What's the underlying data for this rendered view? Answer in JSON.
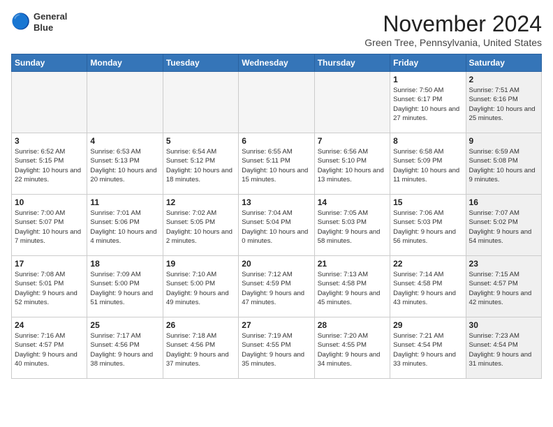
{
  "header": {
    "logo_line1": "General",
    "logo_line2": "Blue",
    "month": "November 2024",
    "location": "Green Tree, Pennsylvania, United States"
  },
  "weekdays": [
    "Sunday",
    "Monday",
    "Tuesday",
    "Wednesday",
    "Thursday",
    "Friday",
    "Saturday"
  ],
  "weeks": [
    [
      {
        "day": "",
        "info": "",
        "empty": true
      },
      {
        "day": "",
        "info": "",
        "empty": true
      },
      {
        "day": "",
        "info": "",
        "empty": true
      },
      {
        "day": "",
        "info": "",
        "empty": true
      },
      {
        "day": "",
        "info": "",
        "empty": true
      },
      {
        "day": "1",
        "info": "Sunrise: 7:50 AM\nSunset: 6:17 PM\nDaylight: 10 hours and 27 minutes.",
        "empty": false,
        "shaded": false
      },
      {
        "day": "2",
        "info": "Sunrise: 7:51 AM\nSunset: 6:16 PM\nDaylight: 10 hours and 25 minutes.",
        "empty": false,
        "shaded": true
      }
    ],
    [
      {
        "day": "3",
        "info": "Sunrise: 6:52 AM\nSunset: 5:15 PM\nDaylight: 10 hours and 22 minutes.",
        "empty": false,
        "shaded": false
      },
      {
        "day": "4",
        "info": "Sunrise: 6:53 AM\nSunset: 5:13 PM\nDaylight: 10 hours and 20 minutes.",
        "empty": false,
        "shaded": false
      },
      {
        "day": "5",
        "info": "Sunrise: 6:54 AM\nSunset: 5:12 PM\nDaylight: 10 hours and 18 minutes.",
        "empty": false,
        "shaded": false
      },
      {
        "day": "6",
        "info": "Sunrise: 6:55 AM\nSunset: 5:11 PM\nDaylight: 10 hours and 15 minutes.",
        "empty": false,
        "shaded": false
      },
      {
        "day": "7",
        "info": "Sunrise: 6:56 AM\nSunset: 5:10 PM\nDaylight: 10 hours and 13 minutes.",
        "empty": false,
        "shaded": false
      },
      {
        "day": "8",
        "info": "Sunrise: 6:58 AM\nSunset: 5:09 PM\nDaylight: 10 hours and 11 minutes.",
        "empty": false,
        "shaded": false
      },
      {
        "day": "9",
        "info": "Sunrise: 6:59 AM\nSunset: 5:08 PM\nDaylight: 10 hours and 9 minutes.",
        "empty": false,
        "shaded": true
      }
    ],
    [
      {
        "day": "10",
        "info": "Sunrise: 7:00 AM\nSunset: 5:07 PM\nDaylight: 10 hours and 7 minutes.",
        "empty": false,
        "shaded": false
      },
      {
        "day": "11",
        "info": "Sunrise: 7:01 AM\nSunset: 5:06 PM\nDaylight: 10 hours and 4 minutes.",
        "empty": false,
        "shaded": false
      },
      {
        "day": "12",
        "info": "Sunrise: 7:02 AM\nSunset: 5:05 PM\nDaylight: 10 hours and 2 minutes.",
        "empty": false,
        "shaded": false
      },
      {
        "day": "13",
        "info": "Sunrise: 7:04 AM\nSunset: 5:04 PM\nDaylight: 10 hours and 0 minutes.",
        "empty": false,
        "shaded": false
      },
      {
        "day": "14",
        "info": "Sunrise: 7:05 AM\nSunset: 5:03 PM\nDaylight: 9 hours and 58 minutes.",
        "empty": false,
        "shaded": false
      },
      {
        "day": "15",
        "info": "Sunrise: 7:06 AM\nSunset: 5:03 PM\nDaylight: 9 hours and 56 minutes.",
        "empty": false,
        "shaded": false
      },
      {
        "day": "16",
        "info": "Sunrise: 7:07 AM\nSunset: 5:02 PM\nDaylight: 9 hours and 54 minutes.",
        "empty": false,
        "shaded": true
      }
    ],
    [
      {
        "day": "17",
        "info": "Sunrise: 7:08 AM\nSunset: 5:01 PM\nDaylight: 9 hours and 52 minutes.",
        "empty": false,
        "shaded": false
      },
      {
        "day": "18",
        "info": "Sunrise: 7:09 AM\nSunset: 5:00 PM\nDaylight: 9 hours and 51 minutes.",
        "empty": false,
        "shaded": false
      },
      {
        "day": "19",
        "info": "Sunrise: 7:10 AM\nSunset: 5:00 PM\nDaylight: 9 hours and 49 minutes.",
        "empty": false,
        "shaded": false
      },
      {
        "day": "20",
        "info": "Sunrise: 7:12 AM\nSunset: 4:59 PM\nDaylight: 9 hours and 47 minutes.",
        "empty": false,
        "shaded": false
      },
      {
        "day": "21",
        "info": "Sunrise: 7:13 AM\nSunset: 4:58 PM\nDaylight: 9 hours and 45 minutes.",
        "empty": false,
        "shaded": false
      },
      {
        "day": "22",
        "info": "Sunrise: 7:14 AM\nSunset: 4:58 PM\nDaylight: 9 hours and 43 minutes.",
        "empty": false,
        "shaded": false
      },
      {
        "day": "23",
        "info": "Sunrise: 7:15 AM\nSunset: 4:57 PM\nDaylight: 9 hours and 42 minutes.",
        "empty": false,
        "shaded": true
      }
    ],
    [
      {
        "day": "24",
        "info": "Sunrise: 7:16 AM\nSunset: 4:57 PM\nDaylight: 9 hours and 40 minutes.",
        "empty": false,
        "shaded": false
      },
      {
        "day": "25",
        "info": "Sunrise: 7:17 AM\nSunset: 4:56 PM\nDaylight: 9 hours and 38 minutes.",
        "empty": false,
        "shaded": false
      },
      {
        "day": "26",
        "info": "Sunrise: 7:18 AM\nSunset: 4:56 PM\nDaylight: 9 hours and 37 minutes.",
        "empty": false,
        "shaded": false
      },
      {
        "day": "27",
        "info": "Sunrise: 7:19 AM\nSunset: 4:55 PM\nDaylight: 9 hours and 35 minutes.",
        "empty": false,
        "shaded": false
      },
      {
        "day": "28",
        "info": "Sunrise: 7:20 AM\nSunset: 4:55 PM\nDaylight: 9 hours and 34 minutes.",
        "empty": false,
        "shaded": false
      },
      {
        "day": "29",
        "info": "Sunrise: 7:21 AM\nSunset: 4:54 PM\nDaylight: 9 hours and 33 minutes.",
        "empty": false,
        "shaded": false
      },
      {
        "day": "30",
        "info": "Sunrise: 7:23 AM\nSunset: 4:54 PM\nDaylight: 9 hours and 31 minutes.",
        "empty": false,
        "shaded": true
      }
    ]
  ]
}
